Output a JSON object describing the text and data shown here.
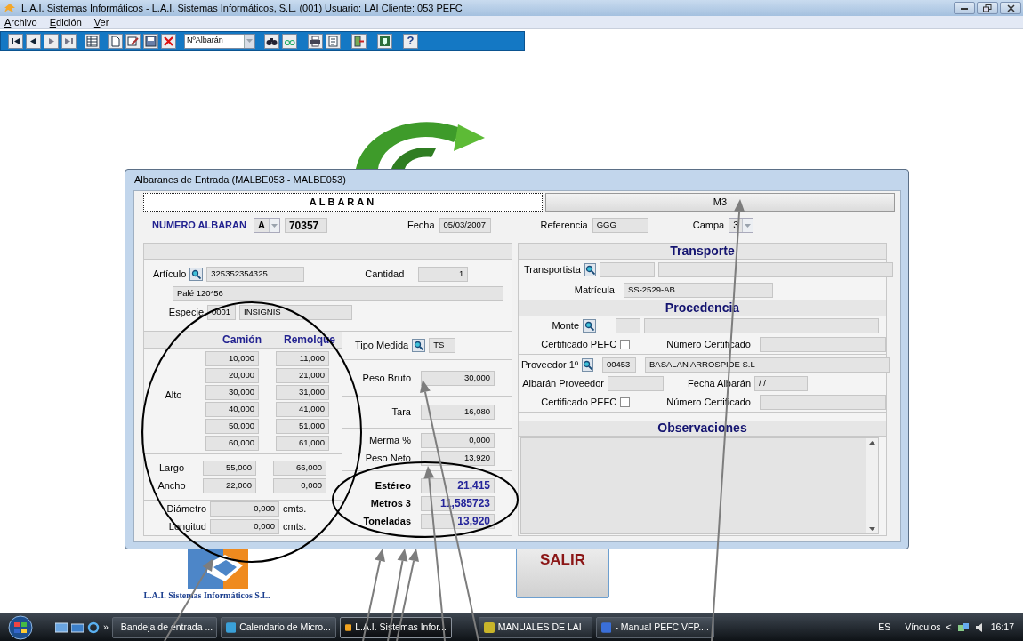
{
  "window": {
    "title": "L.A.I. Sistemas Informáticos - L.A.I. Sistemas Informáticos, S.L. (001)  Usuario: LAI   Cliente: 053  PEFC"
  },
  "menu": [
    "Archivo",
    "Edición",
    "Ver"
  ],
  "toolbar": {
    "search_combo": "NºAlbarán",
    "help_label": "?"
  },
  "dialog": {
    "title": "Albaranes de Entrada (MALBE053 - MALBE053)",
    "tabs": [
      {
        "label": "ALBARAN",
        "selected": true
      },
      {
        "label": "M3",
        "selected": false
      }
    ],
    "header": {
      "numero_label": "NUMERO ALBARAN",
      "serie": "A",
      "numero": "70357",
      "fecha_label": "Fecha",
      "fecha": "05/03/2007",
      "referencia_label": "Referencia",
      "referencia": "GGG",
      "campa_label": "Campa",
      "campa": "3"
    },
    "articulo": {
      "label": "Artículo",
      "code": "325352354325",
      "cantidad_label": "Cantidad",
      "cantidad": "1",
      "description": "Palé 120*56",
      "especie_label": "Especie",
      "especie_code": "0001",
      "especie_name": "INSIGNIS"
    },
    "medidas": {
      "columns": [
        "Camión",
        "Remolque"
      ],
      "alto_label": "Alto",
      "alto": [
        [
          "10,000",
          "11,000"
        ],
        [
          "20,000",
          "21,000"
        ],
        [
          "30,000",
          "31,000"
        ],
        [
          "40,000",
          "41,000"
        ],
        [
          "50,000",
          "51,000"
        ],
        [
          "60,000",
          "61,000"
        ]
      ],
      "largo": {
        "label": "Largo",
        "values": [
          "55,000",
          "66,000"
        ]
      },
      "ancho": {
        "label": "Ancho",
        "values": [
          "22,000",
          "0,000"
        ]
      },
      "diametro": {
        "label": "Diámetro",
        "value": "0,000",
        "unit": "cmts."
      },
      "longitud": {
        "label": "Longitud",
        "value": "0,000",
        "unit": "cmts."
      }
    },
    "pesos": {
      "tipo_label": "Tipo Medida",
      "tipo": "TS",
      "peso_bruto": {
        "label": "Peso Bruto",
        "value": "30,000"
      },
      "tara": {
        "label": "Tara",
        "value": "16,080"
      },
      "merma": {
        "label": "Merma %",
        "value": "0,000"
      },
      "peso_neto": {
        "label": "Peso Neto",
        "value": "13,920"
      },
      "totals": [
        {
          "label": "Estéreo",
          "value": "21,415"
        },
        {
          "label": "Metros 3",
          "value": "11,585723"
        },
        {
          "label": "Toneladas",
          "value": "13,920"
        }
      ]
    },
    "transporte": {
      "title": "Transporte",
      "transportista_label": "Transportista",
      "matricula_label": "Matrícula",
      "matricula": "SS-2529-AB"
    },
    "procedencia": {
      "title": "Procedencia",
      "monte_label": "Monte",
      "certificado": {
        "label": "Certificado PEFC",
        "checked": false
      },
      "numero_certificado_label": "Número Certificado",
      "proveedor_label": "Proveedor 1º",
      "proveedor_code": "00453",
      "proveedor_name": "BASALAN ARROSPIDE S.L",
      "albaran_proveedor_label": "Albarán Proveedor",
      "fecha_albaran_label": "Fecha Albarán",
      "fecha_albaran": " / /",
      "certificado_2": {
        "label": "Certificado PEFC",
        "checked": false
      },
      "numero_certificado_2_label": "Número Certificado"
    },
    "observaciones": {
      "title": "Observaciones"
    }
  },
  "desktop": {
    "company_caption": "L.A.I. Sistemas Informáticos S.L.",
    "exit_button": "SALIR"
  },
  "taskbar": {
    "more": "»",
    "items": [
      {
        "label": "Bandeja de entrada ...",
        "selected": false
      },
      {
        "label": "Calendario de Micro...",
        "selected": false
      },
      {
        "label": "L.A.I. Sistemas Infor...",
        "selected": true
      },
      {
        "label": "MANUALES DE LAI",
        "selected": false
      },
      {
        "label": "- Manual PEFC VFP....",
        "selected": false
      }
    ],
    "language": "ES",
    "links": "Vínculos",
    "links_arrow": "<",
    "clock": "16:17"
  }
}
